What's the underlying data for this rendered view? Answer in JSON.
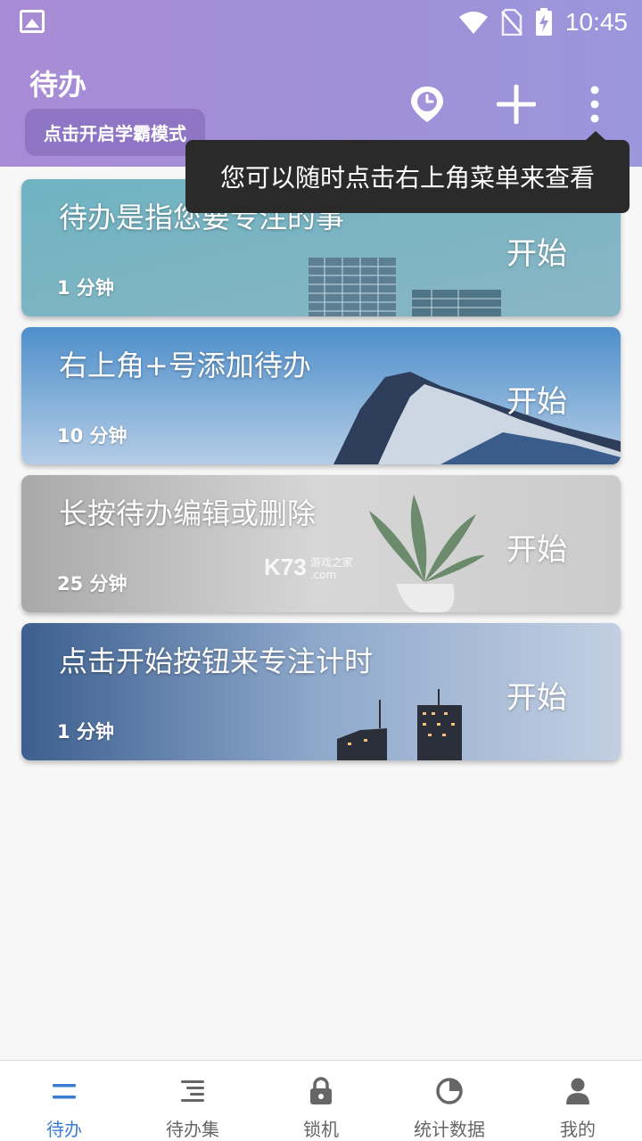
{
  "status_bar": {
    "time": "10:45"
  },
  "header": {
    "title": "待办",
    "mode_button": "点击开启学霸模式",
    "icons": [
      "location-clock-icon",
      "plus-icon",
      "more-vert-icon"
    ]
  },
  "tooltip": {
    "text": "您可以随时点击右上角菜单来查看"
  },
  "tasks": [
    {
      "title": "待办是指您要专注的事",
      "duration": "1 分钟",
      "action": "开始"
    },
    {
      "title": "右上角+号添加待办",
      "duration": "10 分钟",
      "action": "开始"
    },
    {
      "title": "长按待办编辑或删除",
      "duration": "25 分钟",
      "action": "开始"
    },
    {
      "title": "点击开始按钮来专注计时",
      "duration": "1 分钟",
      "action": "开始"
    }
  ],
  "watermark": {
    "brand": "K73",
    "sub1": "游戏之家",
    "sub2": ".com"
  },
  "nav": [
    {
      "label": "待办",
      "icon": "list-icon",
      "active": true
    },
    {
      "label": "待办集",
      "icon": "stacked-list-icon",
      "active": false
    },
    {
      "label": "锁机",
      "icon": "lock-icon",
      "active": false
    },
    {
      "label": "统计数据",
      "icon": "pie-chart-icon",
      "active": false
    },
    {
      "label": "我的",
      "icon": "person-icon",
      "active": false
    }
  ],
  "colors": {
    "accent": "#3a7bd5",
    "header": "#a493d8",
    "tooltip": "#2a2a2a"
  }
}
